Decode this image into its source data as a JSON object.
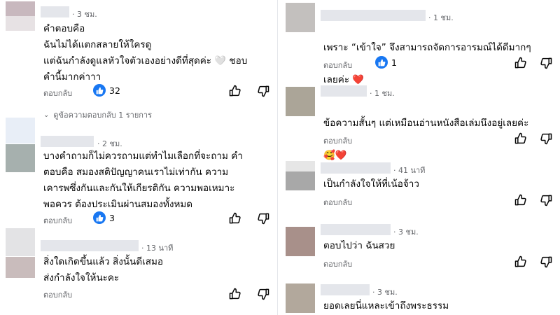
{
  "colors": {
    "like_blue": "#1877f2",
    "heart_red": "#e41e3f",
    "meta_gray": "#65676b"
  },
  "left": {
    "c1": {
      "time": "· 3 ชม.",
      "text": "คำตอบคือ\nฉันไม่ได้แตกสลายให้ใครดู\nแต่ฉันกำลังดูแลหัวใจตัวเองอย่างดีที่สุดค่ะ 🤍 ชอบ\nคำนี้มากค่าาา",
      "reply": "ตอบกลับ",
      "likes": "32",
      "view_replies": "ดูข้อความตอบกลับ 1 รายการ"
    },
    "c2": {
      "time": "· 2 ชม.",
      "text": "บางคำถามก็ไม่ควรถามแต่ทำไมเลือกที่จะถาม คำ\nตอบคือ  สมองสติปัญญาคนเราไม่เท่ากัน ความ\nเคารพซึ่งกันและกันให้เกียรติกัน ความพอเหมาะ\nพอควร ต้องประเมินผ่านสมองทั้งหมด",
      "reply": "ตอบกลับ",
      "likes": "3"
    },
    "c3": {
      "time": "· 13 นาที",
      "text": "สิ่งใดเกิดขึ้นแล้ว สิ่งนั้นดีเสมอ\nส่งกำลังใจให้นะคะ",
      "reply": "ตอบกลับ"
    }
  },
  "right": {
    "c1": {
      "time": "· 1 ชม.",
      "text_a": "เพราะ “เข้าใจ” จึงสามารถจัดการอารมณ์ได้ดีมากๆ",
      "text_b": "เลยค่ะ",
      "emoji": "❤️",
      "reply": "ตอบกลับ",
      "likes": "1"
    },
    "c2": {
      "time": "· 1 ชม.",
      "text_a": "ข้อความสั้นๆ แต่เหมือนอ่านหนังสือเล่มนึงอยู่เลยค่ะ",
      "emoji": "🥰❤️",
      "reply": "ตอบกลับ"
    },
    "c3": {
      "time": "· 41 นาที",
      "text": "เป็นกำลังใจให้ที่เน้อจ้าว",
      "reply": "ตอบกลับ"
    },
    "c4": {
      "time": "· 3 ชม.",
      "text": "ตอบไปว่า ฉันสวย",
      "reply": "ตอบกลับ"
    },
    "c5": {
      "time": "· 3 ชม.",
      "text": "ยอดเลยนี่แหละเข้าถึงพระธรรม"
    }
  }
}
